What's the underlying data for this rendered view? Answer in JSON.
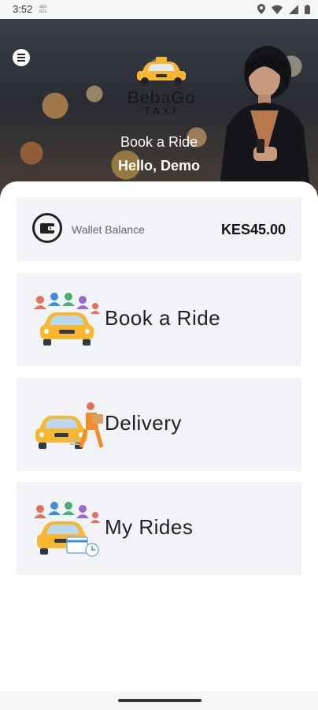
{
  "status_bar": {
    "time": "3:52",
    "mini_text": "abc\nd2s"
  },
  "header": {
    "brand_name": "BebaGo",
    "brand_sub": "TAXI",
    "title": "Book a Ride",
    "greeting": "Hello, Demo"
  },
  "wallet": {
    "label": "Wallet Balance",
    "amount": "KES45.00"
  },
  "menu_tiles": [
    {
      "label": "Book a Ride",
      "icon": "car-with-passengers-icon"
    },
    {
      "label": "Delivery",
      "icon": "delivery-courier-icon"
    },
    {
      "label": "My Rides",
      "icon": "ride-history-icon"
    }
  ],
  "colors": {
    "taxi_yellow": "#f7b731",
    "card_bg": "#f2f3f7",
    "accent_blue": "#3d8fdc"
  }
}
